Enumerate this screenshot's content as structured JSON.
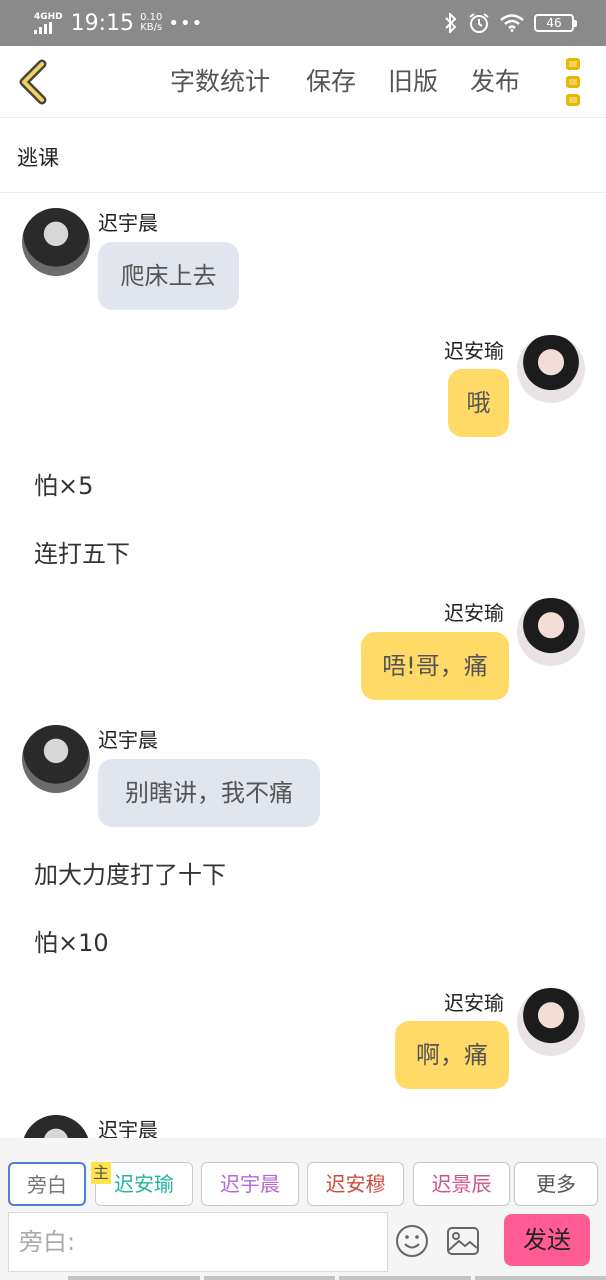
{
  "status_bar": {
    "network": "4GHD",
    "time": "19:15",
    "speed_value": "0.10",
    "speed_unit": "KB/s",
    "more": "•••",
    "battery": "46",
    "icons": [
      "bluetooth-icon",
      "alarm-icon",
      "wifi-icon",
      "battery-icon"
    ]
  },
  "toolbar": {
    "back_icon": "chevron-left-icon",
    "word_count": "字数统计",
    "save": "保存",
    "old_version": "旧版",
    "publish": "发布",
    "menu_icon": "three-dots-vertical-icon",
    "accent": "#e8b800"
  },
  "chapter": {
    "title": "逃课"
  },
  "messages": [
    {
      "type": "left",
      "name": "迟宇晨",
      "text": "爬床上去"
    },
    {
      "type": "right",
      "name": "迟安瑜",
      "text": "哦"
    },
    {
      "type": "narration",
      "text": "怕×5"
    },
    {
      "type": "narration",
      "text": "连打五下"
    },
    {
      "type": "right",
      "name": "迟安瑜",
      "text": "唔!哥，痛"
    },
    {
      "type": "left",
      "name": "迟宇晨",
      "text": "别瞎讲，我不痛"
    },
    {
      "type": "narration",
      "text": "加大力度打了十下"
    },
    {
      "type": "narration",
      "text": "怕×10"
    },
    {
      "type": "right",
      "name": "迟安瑜",
      "text": "啊，痛"
    },
    {
      "type": "left",
      "name": "迟宇晨",
      "text": ""
    }
  ],
  "roles": {
    "narration": "旁白",
    "main_tag": "主",
    "role1": "迟安瑜",
    "role2": "迟宇晨",
    "role3": "迟安穆",
    "role4": "迟景辰",
    "more": "更多"
  },
  "input": {
    "placeholder": "旁白:",
    "send": "发送",
    "send_color": "#ff5c96"
  }
}
